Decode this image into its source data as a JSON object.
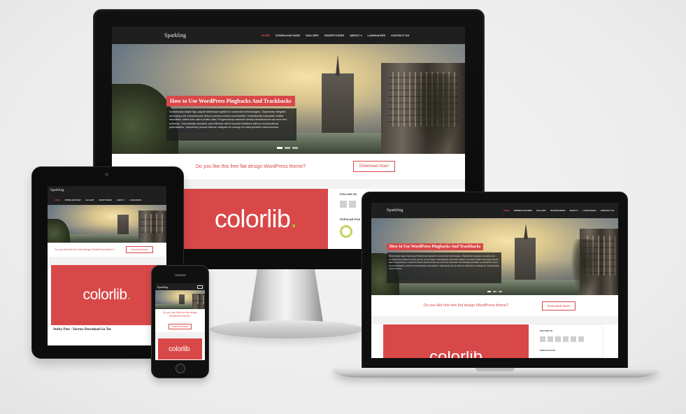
{
  "site": {
    "brand": "Sparkling",
    "menu": [
      "HOME",
      "DOWNLOAD NOW",
      "GALLERY",
      "SHORTCODES",
      "ABOUT ▾",
      "LANGUAGES",
      "CONTACT US"
    ],
    "hero_title": "How to Use WordPress Pingbacks And Trackbacks",
    "hero_text": "Dynamically target high-payoff intellectual capital for customized technologies. Objectively integrate emerging core competencies before process-centric communities. Dramatically evisculate holistic innovation rather than client-centric data. Progressively maximize timely infrastructures via error-free schemas. Dramatically actualize cost-effective client-focused initiatives without functionalized potentialities. Objectively pursue diverse catalysts for change for interoperable meta-services.",
    "cta_question": "Do you like this free flat design WordPress theme?",
    "cta_button": "Download Now!",
    "colorlib_word": "colorlib",
    "colorlib_dot": ".",
    "follow_us": "FOLLOW US",
    "popular_posts": "POPULAR POS",
    "tablet_cta_question": "Do you like this free flat design WordPress theme?",
    "tablet_cta_button": "Download Now!",
    "tablet_post_title": "Sticky Post - Yarrow Download Go Tee",
    "phone_cta_question": "Do you like this free flat design WordPress theme?",
    "phone_cta_button": "Download Now!"
  },
  "colors": {
    "accent": "#d94848",
    "nav": "#1f1f1f",
    "colorlib_dot": "#9acd32"
  }
}
